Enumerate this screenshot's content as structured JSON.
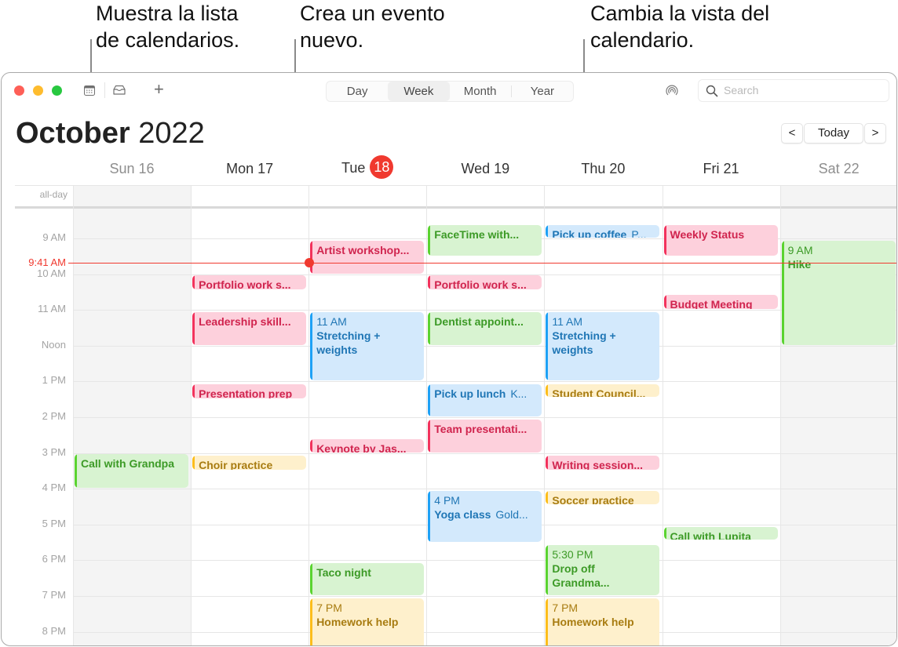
{
  "callouts": [
    {
      "id": "calendars",
      "text": "Muestra la lista\nde calendarios."
    },
    {
      "id": "new-event",
      "text": "Crea un evento\nnuevo."
    },
    {
      "id": "view",
      "text": "Cambia la vista del\ncalendario."
    }
  ],
  "toolbar": {
    "calendar_list_icon": "calendar-list-icon",
    "inbox_icon": "inbox-tray-icon",
    "add_label": "+",
    "views": [
      "Day",
      "Week",
      "Month",
      "Year"
    ],
    "active_view": "Week",
    "airdrop_icon": "airdrop-icon",
    "search_placeholder": "Search"
  },
  "header": {
    "month": "October",
    "year": "2022",
    "prev_label": "<",
    "today_label": "Today",
    "next_label": ">"
  },
  "days": [
    {
      "label": "Sun 16",
      "weekend": true
    },
    {
      "label": "Mon 17",
      "weekend": false
    },
    {
      "label": "Tue",
      "badge": "18",
      "weekend": false,
      "today": true
    },
    {
      "label": "Wed 19",
      "weekend": false
    },
    {
      "label": "Thu 20",
      "weekend": false
    },
    {
      "label": "Fri 21",
      "weekend": false
    },
    {
      "label": "Sat 22",
      "weekend": true
    }
  ],
  "all_day_label": "all-day",
  "hours": [
    "9 AM",
    "10 AM",
    "11 AM",
    "Noon",
    "1 PM",
    "2 PM",
    "3 PM",
    "4 PM",
    "5 PM",
    "6 PM",
    "7 PM",
    "8 PM"
  ],
  "current_time": {
    "label": "9:41 AM",
    "hour": 9.683
  },
  "colors": {
    "red": {
      "bg": "#fdd0dc",
      "bar": "#f2325c",
      "text": "#d0244e"
    },
    "green": {
      "bg": "#d8f3d1",
      "bar": "#5ad330",
      "text": "#3c9a26"
    },
    "blue": {
      "bg": "#d3e9fc",
      "bar": "#1ea1f5",
      "text": "#1f76b5"
    },
    "yellow": {
      "bg": "#fef0cc",
      "bar": "#fcbd1b",
      "text": "#a87c11"
    },
    "now": "#f0392f"
  },
  "events": [
    {
      "day": 0,
      "start": 15.0,
      "end": 16.0,
      "color": "green",
      "title": "Call with Grandpa"
    },
    {
      "day": 1,
      "start": 10.0,
      "end": 10.45,
      "color": "red",
      "title": "Portfolio work s..."
    },
    {
      "day": 1,
      "start": 11.05,
      "end": 12.0,
      "color": "red",
      "title": "Leadership skill..."
    },
    {
      "day": 1,
      "start": 13.05,
      "end": 13.5,
      "color": "red",
      "title": "Presentation prep"
    },
    {
      "day": 1,
      "start": 15.05,
      "end": 15.5,
      "color": "yellow",
      "title": "Choir practice"
    },
    {
      "day": 2,
      "start": 9.05,
      "end": 10.0,
      "color": "red",
      "title": "Artist workshop..."
    },
    {
      "day": 2,
      "start": 11.05,
      "end": 13.0,
      "color": "blue",
      "time": "11 AM",
      "title": "Stretching + weights"
    },
    {
      "day": 2,
      "start": 14.6,
      "end": 15.0,
      "color": "red",
      "title": "Keynote by Jas..."
    },
    {
      "day": 2,
      "start": 18.05,
      "end": 19.0,
      "color": "green",
      "title": "Taco night"
    },
    {
      "day": 2,
      "start": 19.05,
      "end": 20.5,
      "color": "yellow",
      "time": "7 PM",
      "title": "Homework help"
    },
    {
      "day": 3,
      "start": 8.6,
      "end": 9.5,
      "color": "green",
      "title": "FaceTime with..."
    },
    {
      "day": 3,
      "start": 10.0,
      "end": 10.45,
      "color": "red",
      "title": "Portfolio work s..."
    },
    {
      "day": 3,
      "start": 11.05,
      "end": 12.0,
      "color": "green",
      "title": "Dentist appoint..."
    },
    {
      "day": 3,
      "start": 13.05,
      "end": 14.0,
      "color": "blue",
      "title": "Pick up lunch",
      "location": "K..."
    },
    {
      "day": 3,
      "start": 14.05,
      "end": 15.0,
      "color": "red",
      "title": "Team presentati..."
    },
    {
      "day": 3,
      "start": 16.05,
      "end": 17.5,
      "color": "blue",
      "time": "4 PM",
      "title": "Yoga class",
      "location": "Gold..."
    },
    {
      "day": 4,
      "start": 8.6,
      "end": 9.0,
      "color": "blue",
      "title": "Pick up coffee",
      "location": "P..."
    },
    {
      "day": 4,
      "start": 11.05,
      "end": 13.0,
      "color": "blue",
      "time": "11 AM",
      "title": "Stretching + weights"
    },
    {
      "day": 4,
      "start": 13.05,
      "end": 13.45,
      "color": "yellow",
      "title": "Student Council..."
    },
    {
      "day": 4,
      "start": 15.05,
      "end": 15.5,
      "color": "red",
      "title": "Writing session..."
    },
    {
      "day": 4,
      "start": 16.05,
      "end": 16.45,
      "color": "yellow",
      "title": "Soccer practice"
    },
    {
      "day": 4,
      "start": 17.55,
      "end": 19.0,
      "color": "green",
      "time": "5:30 PM",
      "title": "Drop off Grandma..."
    },
    {
      "day": 4,
      "start": 19.05,
      "end": 20.5,
      "color": "yellow",
      "time": "7 PM",
      "title": "Homework help"
    },
    {
      "day": 5,
      "start": 8.6,
      "end": 9.5,
      "color": "red",
      "title": "Weekly Status"
    },
    {
      "day": 5,
      "start": 10.55,
      "end": 11.0,
      "color": "red",
      "title": "Budget Meeting"
    },
    {
      "day": 5,
      "start": 17.05,
      "end": 17.45,
      "color": "green",
      "title": "Call with Lupita"
    },
    {
      "day": 6,
      "start": 9.05,
      "end": 12.0,
      "color": "green",
      "time": "9 AM",
      "title": "Hike"
    }
  ]
}
